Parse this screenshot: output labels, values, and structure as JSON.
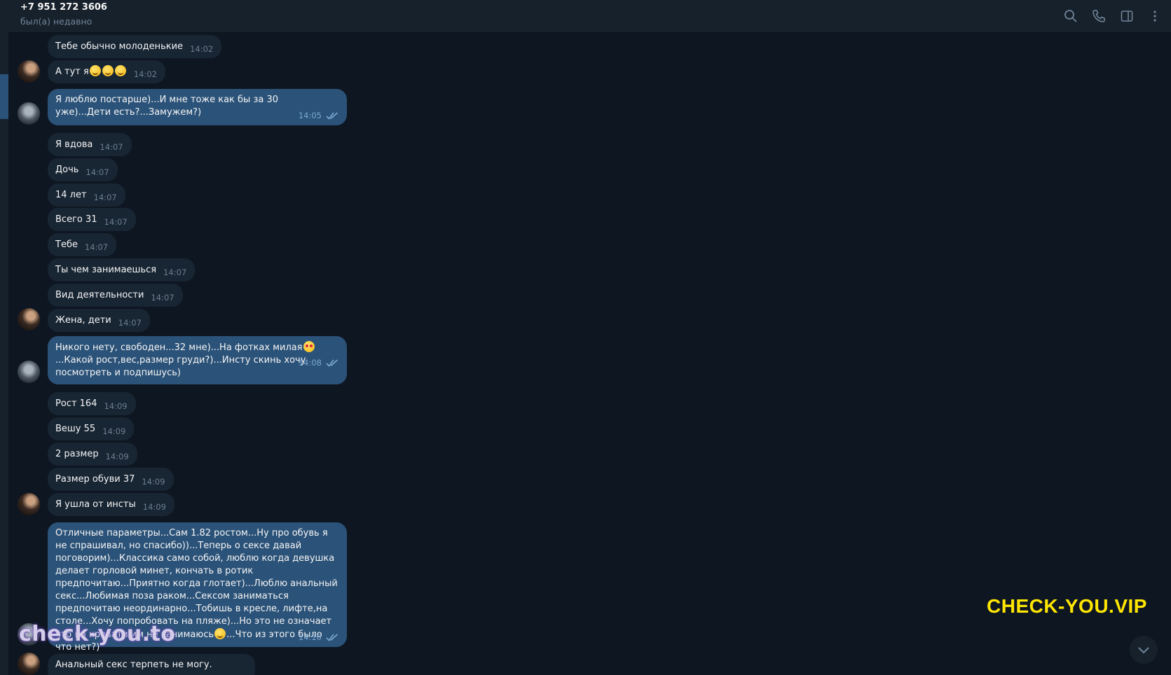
{
  "header": {
    "title": "+7 951 272 3606",
    "status": "был(а) недавно",
    "icons": [
      "search-icon",
      "phone-icon",
      "sidebar-toggle-icon",
      "more-vert-icon"
    ]
  },
  "colors": {
    "background": "#0e1621",
    "incoming_bubble": "#182533",
    "outgoing_bubble": "#2b5278",
    "watermark_yellow": "#ffe600"
  },
  "messages": [
    {
      "dir": "in",
      "text": "Тебе обычно молоденькие",
      "time": "14:02"
    },
    {
      "dir": "in",
      "text": "А тут я",
      "emojis": 3,
      "time": "14:02"
    },
    {
      "dir": "out",
      "text": "Я люблю постарше)...И мне тоже как бы за 30 уже)...Дети есть?...Замужем?)",
      "time": "14:05"
    },
    {
      "dir": "in",
      "text": "Я вдова",
      "time": "14:07"
    },
    {
      "dir": "in",
      "text": "Дочь",
      "time": "14:07"
    },
    {
      "dir": "in",
      "text": "14 лет",
      "time": "14:07"
    },
    {
      "dir": "in",
      "text": "Всего 31",
      "time": "14:07"
    },
    {
      "dir": "in",
      "text": "Тебе",
      "time": "14:07"
    },
    {
      "dir": "in",
      "text": "Ты чем занимаешься",
      "time": "14:07"
    },
    {
      "dir": "in",
      "text": "Вид деятельности",
      "time": "14:07"
    },
    {
      "dir": "in",
      "text": "Жена, дети",
      "time": "14:07"
    },
    {
      "dir": "out",
      "text_a": "Никого нету, свободен...32 мне)...На фотках милая",
      "text_b": "...Какой рост,вес,размер груди?)...Инсту скинь хочу посмотреть и подпишусь)",
      "time": "14:08"
    },
    {
      "dir": "in",
      "text": "Рост 164",
      "time": "14:09"
    },
    {
      "dir": "in",
      "text": "Вешу 55",
      "time": "14:09"
    },
    {
      "dir": "in",
      "text": "2 размер",
      "time": "14:09"
    },
    {
      "dir": "in",
      "text": "Размер обуви 37",
      "time": "14:09"
    },
    {
      "dir": "in",
      "text": "Я ушла от инсты",
      "time": "14:09"
    },
    {
      "dir": "out",
      "text_a": "Отличные параметры...Сам 1.82 ростом...Ну про обувь я не спрашивал, но спасибо))...Теперь о сексе давай поговорим)...Классика само собой, люблю когда девушка делает горловой минет, кончать в ротик предпочитаю...Приятно когда глотает)...Люблю анальный секс...Любимая поза раком...Сексом заниматься предпочитаю неординарно...Тобишь в кресле, лифте,на столе...Хочу попробовать на пляже)...Но это не означает что на кровати им не занимаюсь",
      "text_b": "...Что из этого было что нет?)",
      "time": "14:10"
    },
    {
      "dir": "in",
      "text": "Анальный секс терпеть не могу.",
      "time": ""
    }
  ],
  "watermarks": {
    "left": "check-you.to",
    "right": "CHECK-YOU.VIP"
  }
}
